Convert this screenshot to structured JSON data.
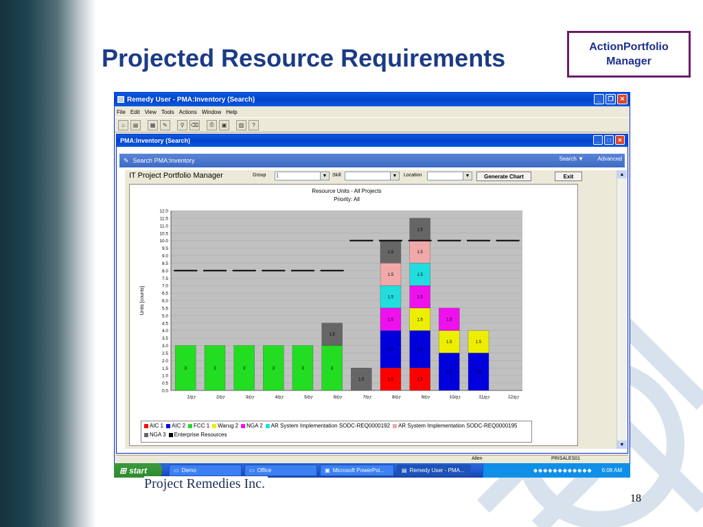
{
  "slide": {
    "title": "Projected Resource Requirements",
    "logo_line1": "ActionPortfolio",
    "logo_line2": "Manager",
    "footer_company": "Project Remedies Inc.",
    "page_number": "18"
  },
  "window": {
    "title": "Remedy User - PMA:Inventory (Search)",
    "menu": [
      "File",
      "Edit",
      "View",
      "Tools",
      "Actions",
      "Window",
      "Help"
    ],
    "controls": [
      "minimize",
      "restore",
      "close"
    ]
  },
  "inner_window": {
    "title": "PMA:Inventory (Search)",
    "search_header": "Search PMA:Inventory",
    "search_menu": "Search",
    "advanced": "Advanced"
  },
  "form": {
    "app_title": "IT Project Portfolio  Manager",
    "group_label": "Group",
    "group_value": "|",
    "skill_label": "Skill",
    "skill_value": "",
    "location_label": "Location",
    "location_value": "",
    "generate_button": "Generate Chart",
    "exit_button": "Exit"
  },
  "status": {
    "user": "Allen",
    "server": "PRISALES01"
  },
  "taskbar": {
    "start": "start",
    "tasks": [
      "Demo",
      "Office",
      "Microsoft PowerPoi...",
      "Remedy User - PMA..."
    ],
    "clock": "6:08 AM"
  },
  "colors": {
    "AIC 1": "#ff0000",
    "AIC 2": "#0000dd",
    "FCC 1": "#22dd22",
    "Warug 2": "#eeee00",
    "NGA 2": "#ee11ee",
    "AR System Implementation SODC-REQ0000192": "#22dddd",
    "AR System Implementation SODC-REQ0000195": "#f0a8a8",
    "NGA 3": "#666666",
    "Enterprise Resources": "#000000"
  },
  "chart_data": {
    "type": "bar",
    "stacked": true,
    "title": "Resource Units - All Projects",
    "subtitle": "Priority: All",
    "xlabel": "",
    "ylabel": "Units [counts]",
    "ylim": [
      0,
      12
    ],
    "yticks": [
      "0.0",
      "0.5",
      "1.0",
      "1.5",
      "2.0",
      "2.5",
      "3.0",
      "3.5",
      "4.0",
      "4.5",
      "5.0",
      "5.5",
      "6.0",
      "6.5",
      "7.0",
      "7.5",
      "8.0",
      "8.5",
      "9.0",
      "9.5",
      "10.0",
      "10.5",
      "11.0",
      "11.5",
      "12.0"
    ],
    "grid": true,
    "legend_position": "bottom",
    "categories": [
      "1/07",
      "2/07",
      "3/07",
      "4/07",
      "5/07",
      "6/07",
      "7/07",
      "8/07",
      "9/07",
      "10/07",
      "11/07",
      "12/07"
    ],
    "series": [
      {
        "name": "AIC 1",
        "values": [
          0,
          0,
          0,
          0,
          0,
          0,
          0,
          1.5,
          1.5,
          0,
          0,
          0
        ],
        "labels": [
          "",
          "",
          "",
          "",
          "",
          "",
          "",
          "1.5",
          "1.5",
          "",
          "",
          ""
        ]
      },
      {
        "name": "AIC 2",
        "values": [
          0,
          0,
          0,
          0,
          0,
          0,
          0,
          2.5,
          2.5,
          2.5,
          2.5,
          0
        ],
        "labels": [
          "",
          "",
          "",
          "",
          "",
          "",
          "",
          "2.5",
          "2.5",
          "2.5",
          "2.5",
          ""
        ]
      },
      {
        "name": "FCC 1",
        "values": [
          3,
          3,
          3,
          3,
          3,
          3,
          0,
          0,
          0,
          0,
          0,
          0
        ],
        "labels": [
          "3",
          "3",
          "3",
          "3",
          "3",
          "3",
          "",
          "",
          "",
          "",
          "",
          ""
        ]
      },
      {
        "name": "Warug 2",
        "values": [
          0,
          0,
          0,
          0,
          0,
          0,
          0,
          0,
          1.5,
          1.5,
          1.5,
          0
        ],
        "labels": [
          "",
          "",
          "",
          "",
          "",
          "",
          "",
          "",
          "1.5",
          "1.5",
          "1.5",
          ""
        ]
      },
      {
        "name": "NGA 2",
        "values": [
          0,
          0,
          0,
          0,
          0,
          0,
          0,
          1.5,
          1.5,
          1.5,
          0,
          0
        ],
        "labels": [
          "",
          "",
          "",
          "",
          "",
          "",
          "",
          "1.5",
          "1.5",
          "1.5",
          "",
          ""
        ]
      },
      {
        "name": "AR System Implementation SODC-REQ0000192",
        "values": [
          0,
          0,
          0,
          0,
          0,
          0,
          0,
          1.5,
          1.5,
          0,
          0,
          0
        ],
        "labels": [
          "",
          "",
          "",
          "",
          "",
          "",
          "",
          "1.5",
          "1.5",
          "",
          "",
          ""
        ]
      },
      {
        "name": "AR System Implementation SODC-REQ0000195",
        "values": [
          0,
          0,
          0,
          0,
          0,
          0,
          0,
          1.5,
          1.5,
          0,
          0,
          0
        ],
        "labels": [
          "",
          "",
          "",
          "",
          "",
          "",
          "",
          "1.5",
          "1.5",
          "",
          "",
          ""
        ]
      },
      {
        "name": "NGA 3",
        "values": [
          0,
          0,
          0,
          0,
          0,
          1.5,
          1.5,
          1.5,
          1.5,
          0,
          0,
          0
        ],
        "labels": [
          "",
          "",
          "",
          "",
          "",
          "1.5",
          "1.5",
          "1.5",
          "1.5",
          "",
          "",
          ""
        ]
      }
    ],
    "line_series": {
      "name": "Enterprise Resources",
      "values": [
        8,
        8,
        8,
        8,
        8,
        8,
        10,
        10,
        10,
        10,
        10,
        10
      ]
    }
  }
}
